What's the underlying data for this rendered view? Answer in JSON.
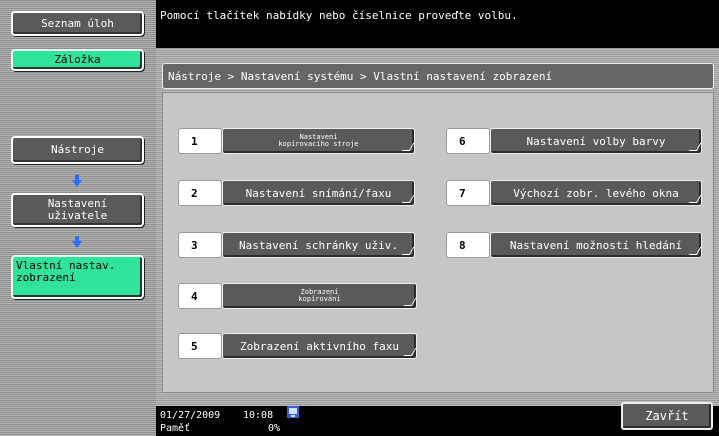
{
  "sidebar": {
    "job_list": "Seznam úloh",
    "bookmark": "Záložka",
    "tools": "Nástroje",
    "user_settings": "Nastavení\nuživatele",
    "custom_display": "Vlastní nastav.\nzobrazení"
  },
  "header": {
    "message": "Pomocí tlačítek nabídky nebo číselnice proveďte volbu.",
    "breadcrumb": "Nástroje > Nastavení systému > Vlastní nastavení zobrazení"
  },
  "menu": {
    "items": [
      {
        "num": "1",
        "label": "Nastavení\nkopírovacího stroje"
      },
      {
        "num": "2",
        "label": "Nastavení snímání/faxu"
      },
      {
        "num": "3",
        "label": "Nastavení schránky uživ."
      },
      {
        "num": "4",
        "label": "Zobrazení\nkopírování"
      },
      {
        "num": "5",
        "label": "Zobrazení aktivního faxu"
      },
      {
        "num": "6",
        "label": "Nastavení volby barvy"
      },
      {
        "num": "7",
        "label": "Výchozí zobr. levého okna"
      },
      {
        "num": "8",
        "label": "Nastavení možností hledání"
      }
    ]
  },
  "status": {
    "date": "01/27/2009",
    "time": "10:08",
    "memory_label": "Paměť",
    "memory_value": "0%",
    "close_label": "Zavřít"
  },
  "colors": {
    "accent_green": "#2fe39a",
    "button_gray": "#5a5a5a",
    "arrow_blue": "#2c6cff"
  }
}
